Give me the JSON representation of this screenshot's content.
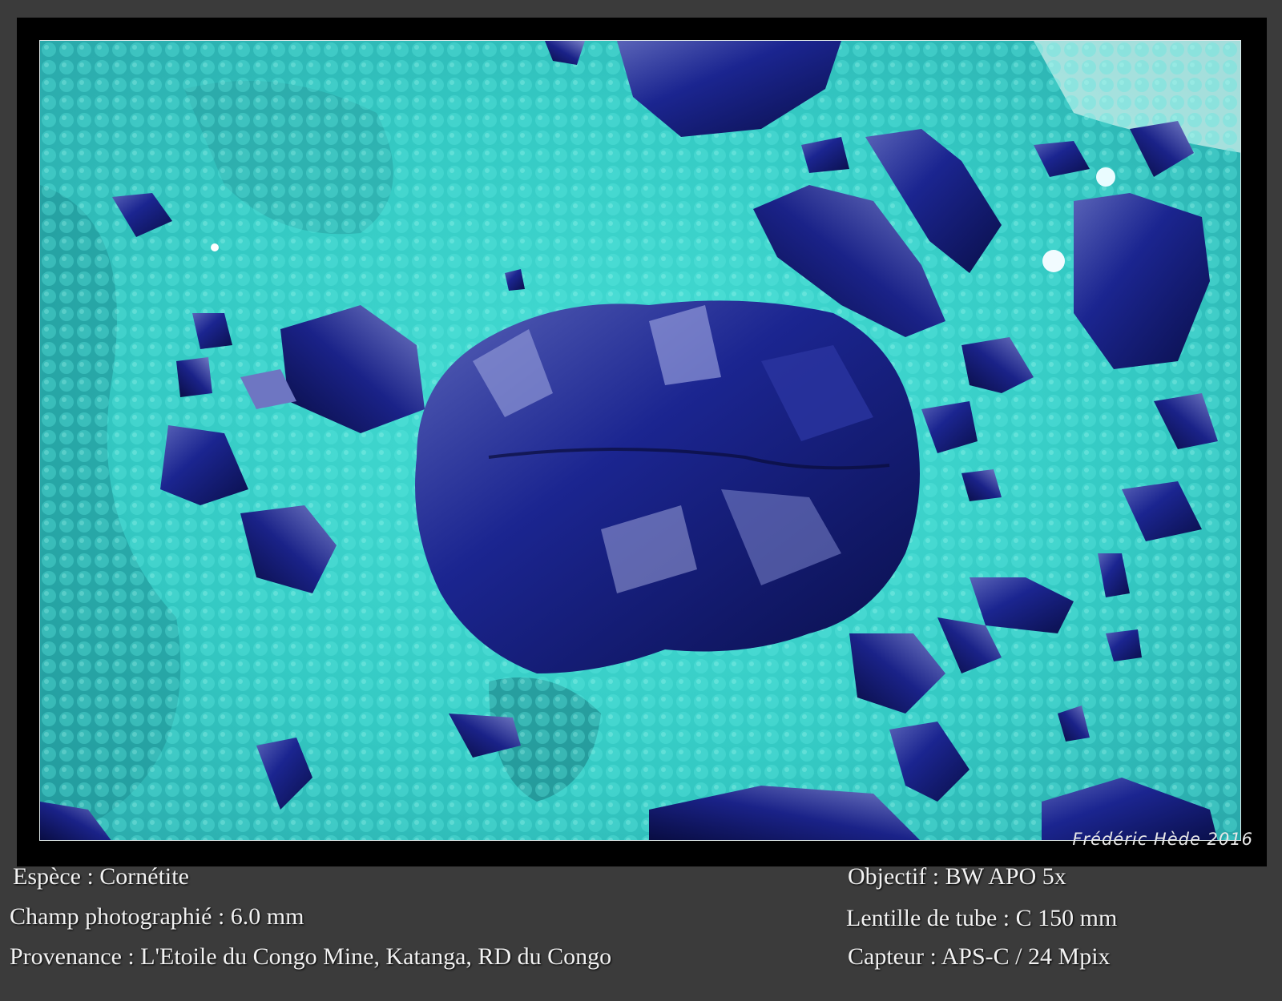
{
  "credit": "Frédéric Hède 2016",
  "left_info": [
    "Espèce : Cornétite",
    "Champ photographié : 6.0 mm",
    "Provenance : L'Etoile du Congo Mine, Katanga, RD du Congo"
  ],
  "right_info": [
    "Objectif : BW APO 5x",
    "Lentille de tube : C 150 mm",
    "Capteur : APS-C / 24 Mpix"
  ],
  "colors": {
    "matrix": "#3fd3cc",
    "crystal": "#10186a",
    "frame": "#000000",
    "background": "#3b3b3b"
  }
}
